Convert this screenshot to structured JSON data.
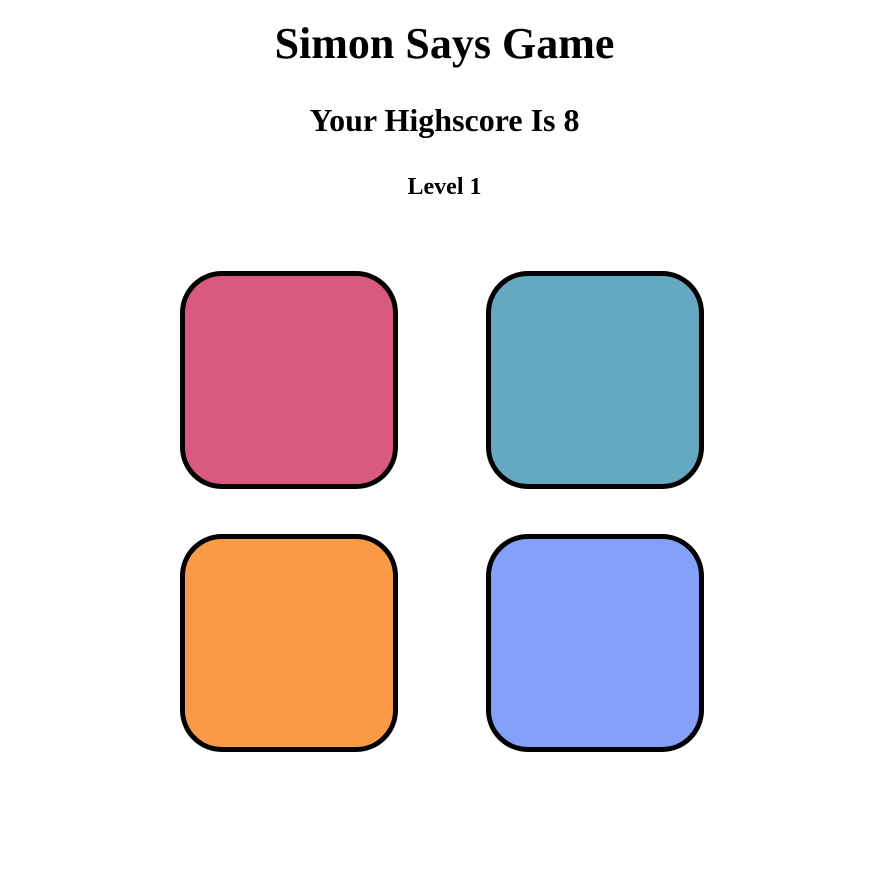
{
  "header": {
    "title": "Simon Says Game",
    "highscore": "Your Highscore Is 8",
    "level": "Level 1"
  },
  "pads": [
    {
      "name": "pink-pad",
      "color": "#d95a7e"
    },
    {
      "name": "teal-pad",
      "color": "#64a9c1"
    },
    {
      "name": "orange-pad",
      "color": "#f99a46"
    },
    {
      "name": "blue-pad",
      "color": "#84a0f8"
    }
  ]
}
